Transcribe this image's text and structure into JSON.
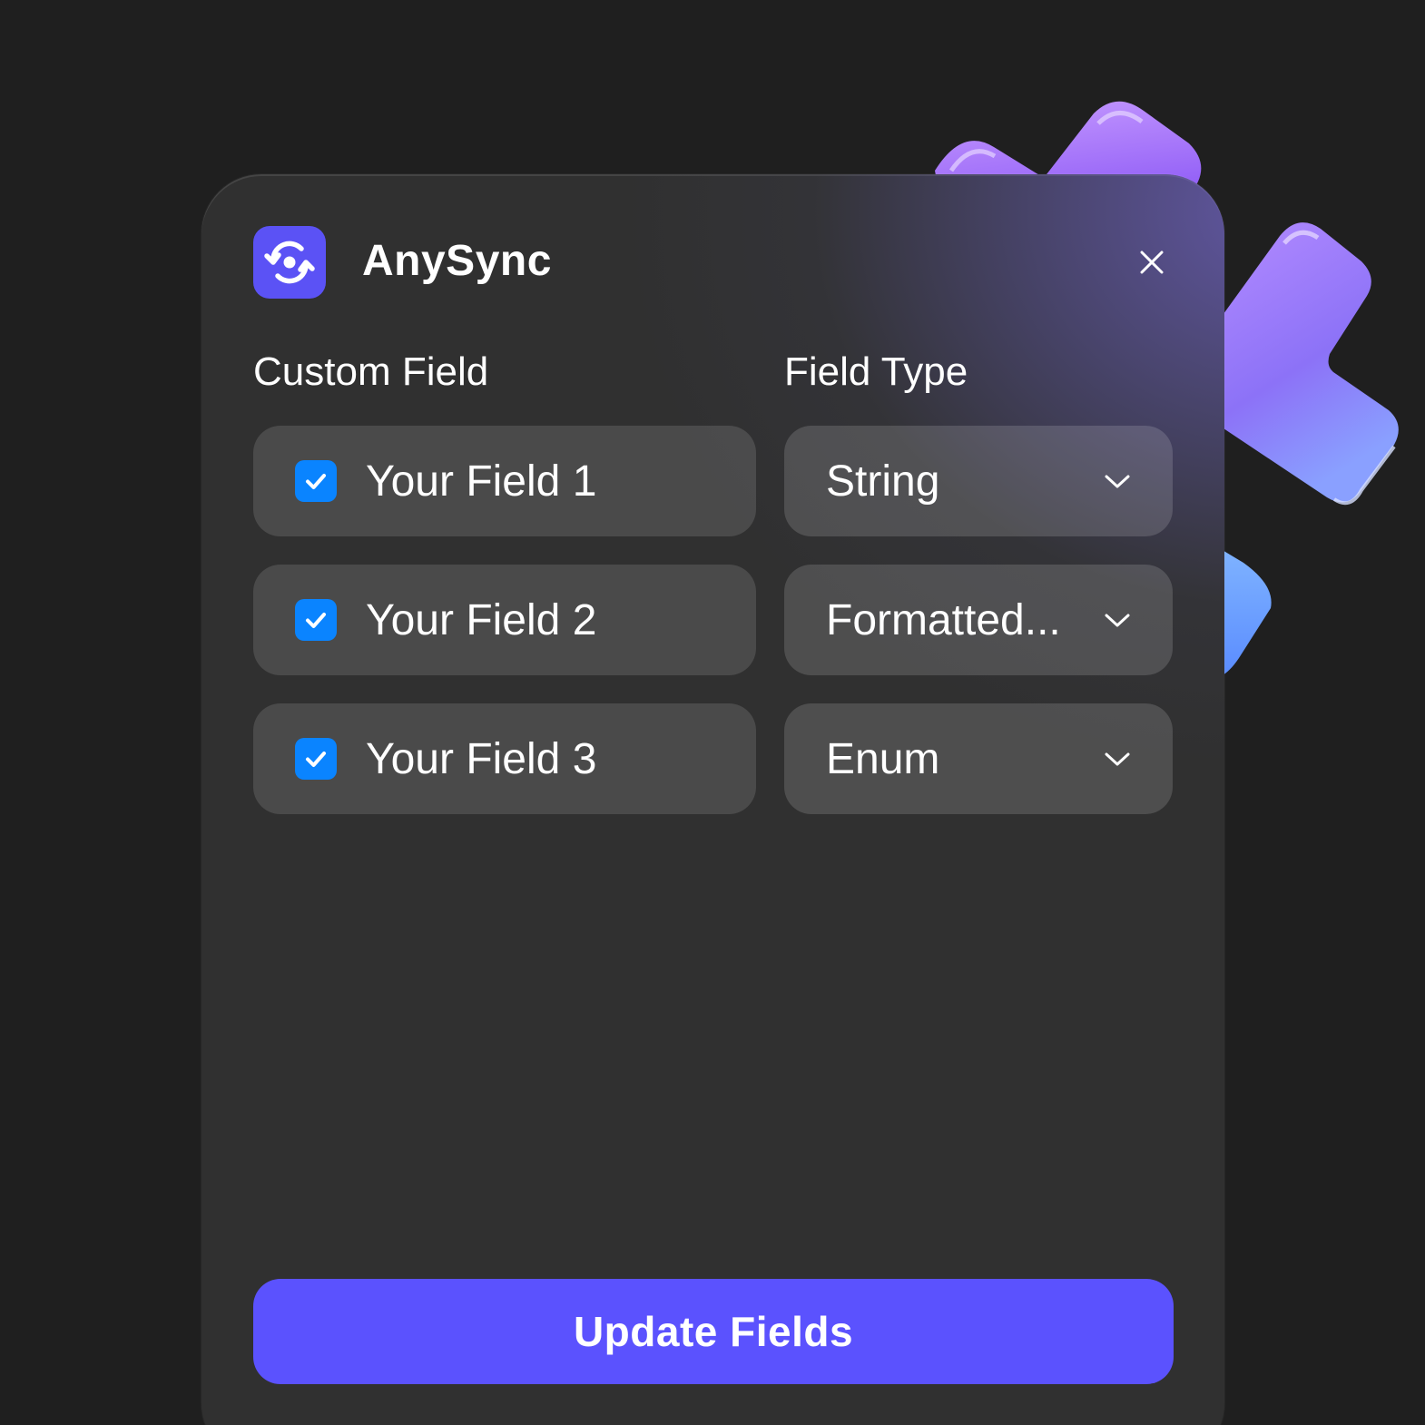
{
  "app": {
    "title": "AnySync",
    "logo_icon": "sync-icon",
    "accent_color": "#5b52f5"
  },
  "columns": {
    "custom_field": "Custom Field",
    "field_type": "Field Type"
  },
  "rows": [
    {
      "label": "Your Field 1",
      "checked": true,
      "type": "String"
    },
    {
      "label": "Your Field 2",
      "checked": true,
      "type": "Formatted..."
    },
    {
      "label": "Your Field 3",
      "checked": true,
      "type": "Enum"
    }
  ],
  "actions": {
    "update_label": "Update Fields",
    "close_icon": "close-icon"
  },
  "colors": {
    "background": "#1f1f1f",
    "panel": "#303030",
    "checkbox": "#0a84ff",
    "button": "#5b52fe"
  }
}
